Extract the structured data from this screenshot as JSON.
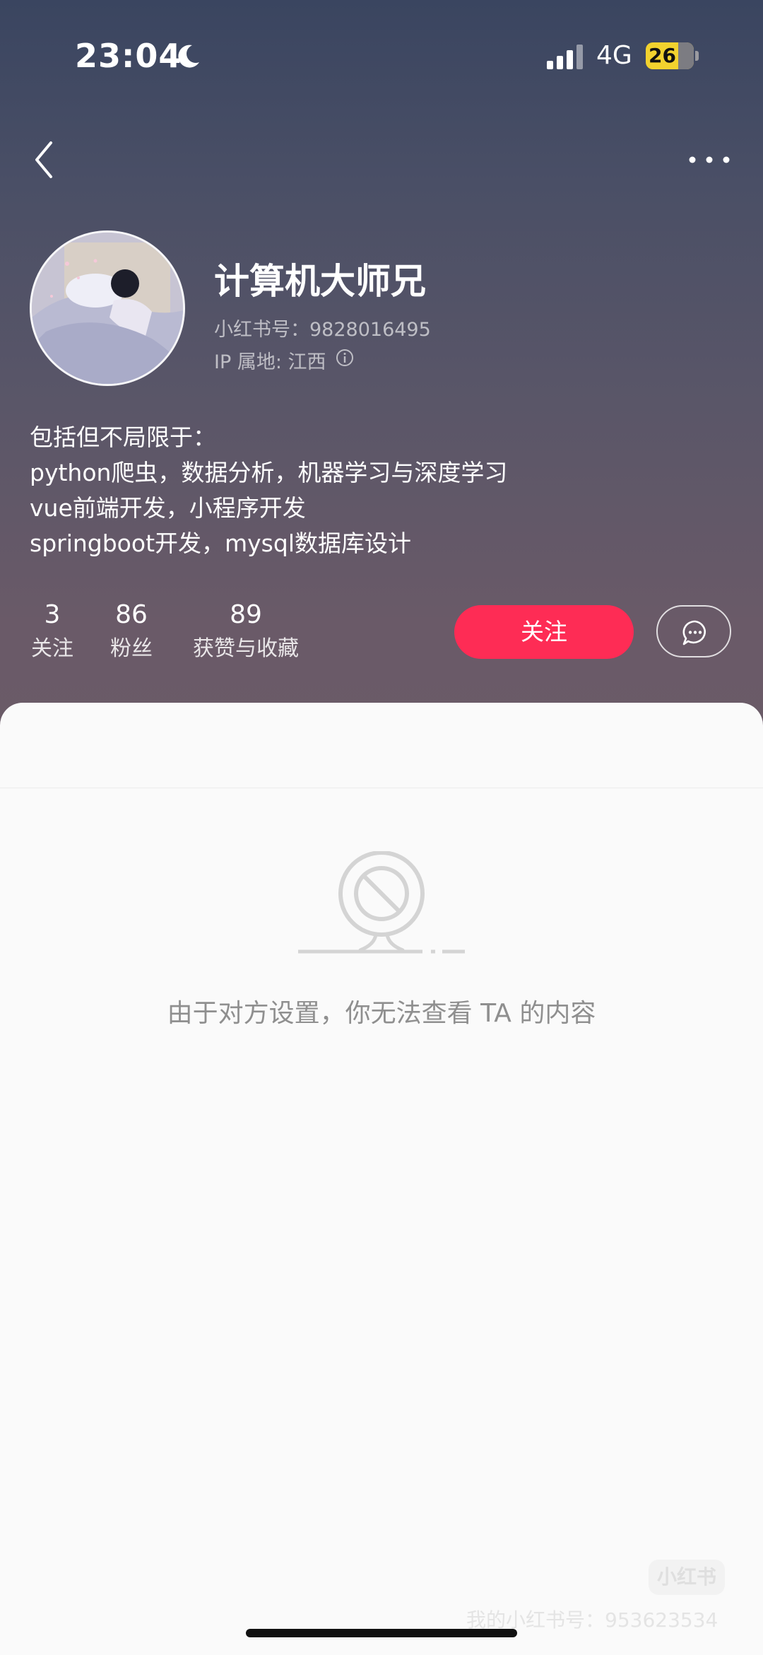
{
  "status_bar": {
    "time": "23:04",
    "network": "4G",
    "battery": "26"
  },
  "profile": {
    "name": "计算机大师兄",
    "id_line": "小红书号：9828016495",
    "ip_line": "IP 属地: 江西",
    "bio": [
      "包括但不局限于：",
      "python爬虫，数据分析，机器学习与深度学习",
      "vue前端开发，小程序开发",
      "springboot开发，mysql数据库设计"
    ]
  },
  "stats": [
    {
      "count": "3",
      "label": "关注"
    },
    {
      "count": "86",
      "label": "粉丝"
    },
    {
      "count": "89",
      "label": "获赞与收藏"
    }
  ],
  "actions": {
    "follow_label": "关注"
  },
  "content": {
    "empty_message": "由于对方设置，你无法查看 TA 的内容"
  },
  "watermark": {
    "logo": "小红书",
    "text": "我的小红书号：953623534"
  },
  "icons": {
    "back": "chevron-left-icon",
    "more": "more-dots-icon",
    "info": "info-icon",
    "message": "chat-bubble-icon",
    "moon": "moon-icon",
    "signal": "signal-icon"
  },
  "colors": {
    "follow_button": "#fe2c55",
    "battery": "#f2d22e"
  }
}
